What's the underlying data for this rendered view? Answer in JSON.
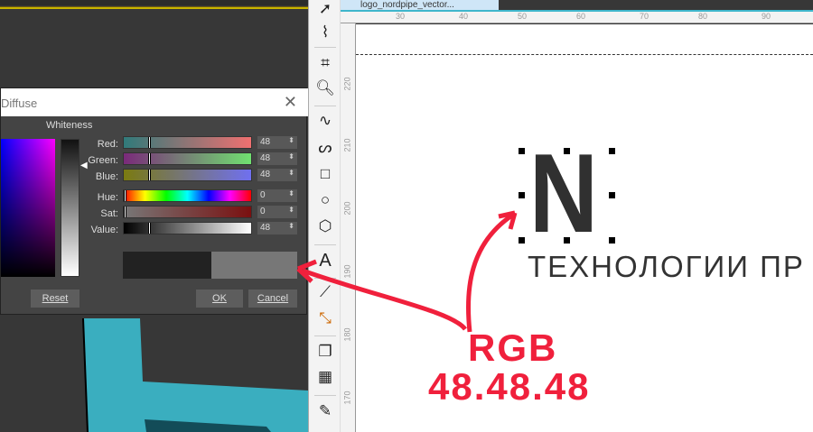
{
  "dialog": {
    "title": "Diffuse",
    "whiteness_label": "Whiteness",
    "rows": [
      {
        "label": "Red:",
        "value": "48"
      },
      {
        "label": "Green:",
        "value": "48"
      },
      {
        "label": "Blue:",
        "value": "48"
      },
      {
        "label": "Hue:",
        "value": "0"
      },
      {
        "label": "Sat:",
        "value": "0"
      },
      {
        "label": "Value:",
        "value": "48"
      }
    ],
    "reset": "Reset",
    "ok": "OK",
    "cancel": "Cancel",
    "new_color": "#303030",
    "old_color": "#777777"
  },
  "document": {
    "tab_title": "logo_nordpipe_vector..."
  },
  "ruler": {
    "h": [
      "30",
      "40",
      "50",
      "60",
      "70",
      "80",
      "90"
    ],
    "v": [
      "220",
      "210",
      "200",
      "190",
      "180",
      "170"
    ]
  },
  "logo": {
    "letter": "N",
    "tagline": "ТЕХНОЛОГИИ ПР",
    "fill": "#303030"
  },
  "annotation": {
    "line1": "RGB",
    "line2": "48.48.48",
    "color": "#f0203c"
  }
}
